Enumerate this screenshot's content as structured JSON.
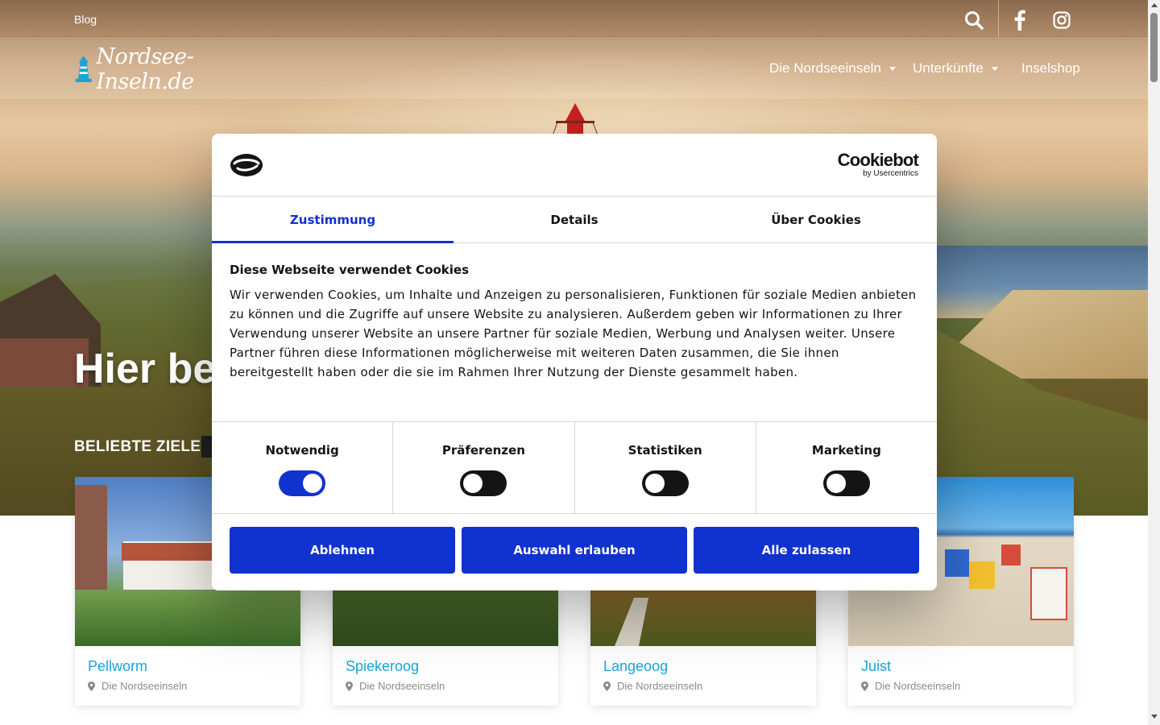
{
  "topbar": {
    "blog_label": "Blog",
    "icons": [
      "search-icon",
      "facebook-icon",
      "instagram-icon"
    ]
  },
  "header": {
    "logo_text": "Nordsee-Inseln.de",
    "nav": [
      {
        "label": "Die Nordseeinseln",
        "has_dropdown": true
      },
      {
        "label": "Unterkünfte",
        "has_dropdown": true
      },
      {
        "label": "Inselshop",
        "has_dropdown": false
      }
    ]
  },
  "hero": {
    "headline": "Hier beg",
    "popular_label": "BELIEBTE ZIELE"
  },
  "cards": [
    {
      "title": "Pellworm",
      "category": "Die Nordseeinseln"
    },
    {
      "title": "Spiekeroog",
      "category": "Die Nordseeinseln"
    },
    {
      "title": "Langeoog",
      "category": "Die Nordseeinseln"
    },
    {
      "title": "Juist",
      "category": "Die Nordseeinseln"
    }
  ],
  "cookie_dialog": {
    "brand_name": "Cookiebot",
    "brand_sub": "by Usercentrics",
    "tabs": [
      {
        "label": "Zustimmung",
        "active": true
      },
      {
        "label": "Details",
        "active": false
      },
      {
        "label": "Über Cookies",
        "active": false
      }
    ],
    "title": "Diese Webseite verwendet Cookies",
    "body": "Wir verwenden Cookies, um Inhalte und Anzeigen zu personalisieren, Funktionen für soziale Medien anbieten zu können und die Zugriffe auf unsere Website zu analysieren. Außerdem geben wir Informationen zu Ihrer Verwendung unserer Website an unsere Partner für soziale Medien, Werbung und Analysen weiter. Unsere Partner führen diese Informationen möglicherweise mit weiteren Daten zusammen, die Sie ihnen bereitgestellt haben oder die sie im Rahmen Ihrer Nutzung der Dienste gesammelt haben.",
    "toggles": [
      {
        "label": "Notwendig",
        "on": true
      },
      {
        "label": "Präferenzen",
        "on": false
      },
      {
        "label": "Statistiken",
        "on": false
      },
      {
        "label": "Marketing",
        "on": false
      }
    ],
    "buttons": {
      "decline": "Ablehnen",
      "allow_selection": "Auswahl erlauben",
      "allow_all": "Alle zulassen"
    },
    "accent_color": "#1032cf"
  },
  "colors": {
    "card_title": "#1aa3d9",
    "meta_text": "#8a8a8a"
  }
}
